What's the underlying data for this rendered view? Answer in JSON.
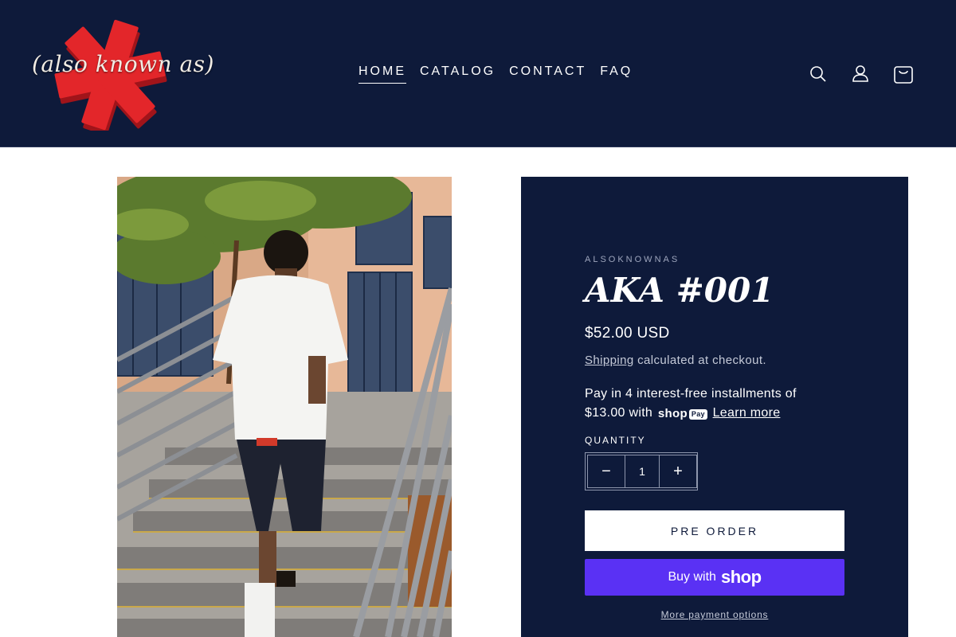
{
  "header": {
    "logo_text": "(also known as)",
    "nav": [
      {
        "label": "HOME",
        "active": true
      },
      {
        "label": "CATALOG",
        "active": false
      },
      {
        "label": "CONTACT",
        "active": false
      },
      {
        "label": "FAQ",
        "active": false
      }
    ],
    "icons": [
      "search-icon",
      "account-icon",
      "cart-icon"
    ]
  },
  "product": {
    "vendor": "ALSOKNOWNAS",
    "title": "AKA #001",
    "price": "$52.00 USD",
    "shipping_link": "Shipping",
    "shipping_rest": " calculated at checkout.",
    "installments_text": "Pay in 4 interest-free installments of $13.00 with",
    "shop_pay_shop": "shop",
    "shop_pay_pay": "Pay",
    "learn_more": "Learn more",
    "quantity_label": "QUANTITY",
    "quantity_value": "1",
    "minus": "−",
    "plus": "+",
    "preorder_label": "PRE ORDER",
    "buy_with": "Buy with",
    "buy_shop": "shop",
    "more_payment": "More payment options"
  },
  "colors": {
    "navy": "#0e1a3a",
    "shop_purple": "#5a31f4",
    "logo_red": "#e3262a"
  }
}
